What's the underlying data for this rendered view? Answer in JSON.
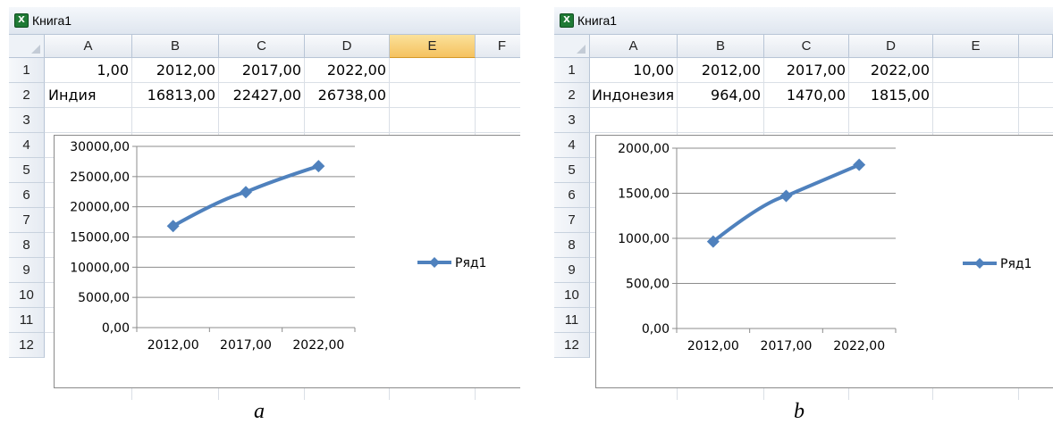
{
  "panels": [
    {
      "id": "a",
      "window_title": "Книга1",
      "app_icon": "excel-icon",
      "columns": [
        "A",
        "B",
        "C",
        "D",
        "E",
        "F"
      ],
      "active_column": "E",
      "rows": [
        "1",
        "2",
        "3",
        "4",
        "5",
        "6",
        "7",
        "8",
        "9",
        "10",
        "11",
        "12"
      ],
      "cells": [
        [
          "1,00",
          "2012,00",
          "2017,00",
          "2022,00"
        ],
        [
          "Индия",
          "16813,00",
          "22427,00",
          "26738,00"
        ]
      ],
      "caption": "a"
    },
    {
      "id": "b",
      "window_title": "Книга1",
      "app_icon": "excel-icon",
      "columns": [
        "A",
        "B",
        "C",
        "D",
        "E"
      ],
      "active_column": "",
      "rows": [
        "1",
        "2",
        "3",
        "4",
        "5",
        "6",
        "7",
        "8",
        "9",
        "10",
        "11",
        "12"
      ],
      "cells": [
        [
          "10,00",
          "2012,00",
          "2017,00",
          "2022,00"
        ],
        [
          "Индонезия",
          "964,00",
          "1470,00",
          "1815,00"
        ]
      ],
      "caption": "b"
    }
  ],
  "chart_data": [
    {
      "type": "line",
      "title": "",
      "categories": [
        "2012,00",
        "2017,00",
        "2022,00"
      ],
      "series": [
        {
          "name": "Ряд1",
          "values": [
            16813,
            22427,
            26738
          ],
          "marker": "diamond",
          "color": "#4f81bd"
        }
      ],
      "y_ticks": [
        "0,00",
        "5000,00",
        "10000,00",
        "15000,00",
        "20000,00",
        "25000,00",
        "30000,00"
      ],
      "ylim": [
        0,
        30000
      ],
      "grid": true,
      "legend": "right"
    },
    {
      "type": "line",
      "title": "",
      "categories": [
        "2012,00",
        "2017,00",
        "2022,00"
      ],
      "series": [
        {
          "name": "Ряд1",
          "values": [
            964,
            1470,
            1815
          ],
          "marker": "diamond",
          "color": "#4f81bd"
        }
      ],
      "y_ticks": [
        "0,00",
        "500,00",
        "1000,00",
        "1500,00",
        "2000,00"
      ],
      "ylim": [
        0,
        2000
      ],
      "grid": true,
      "legend": "right"
    }
  ]
}
